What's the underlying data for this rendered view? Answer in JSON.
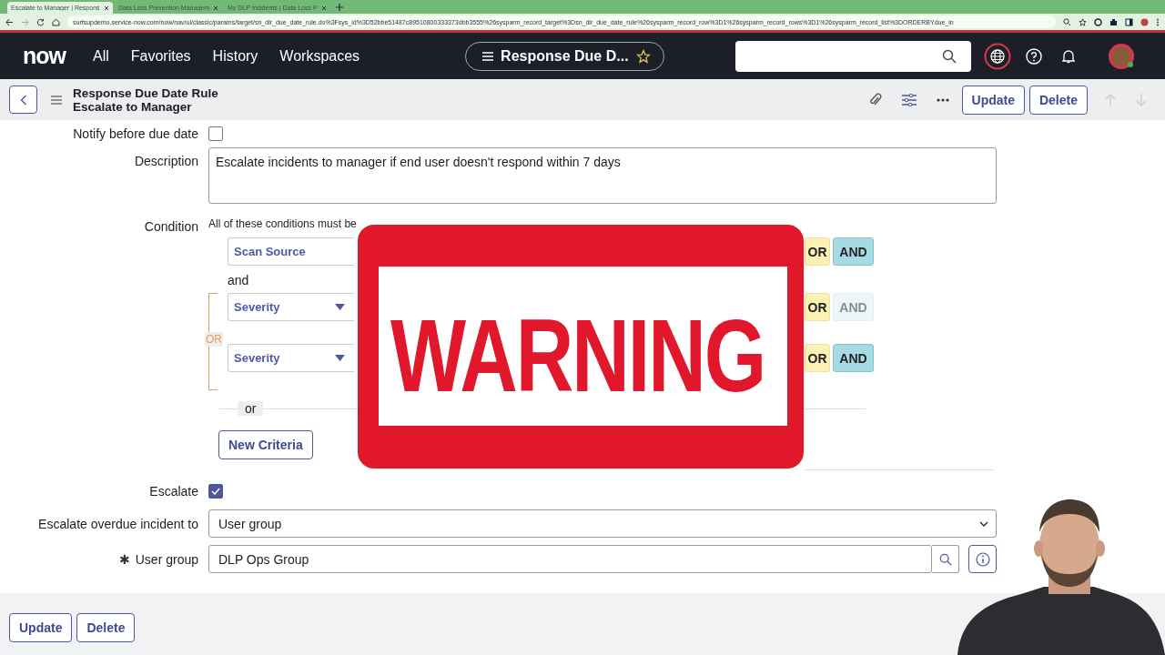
{
  "browser": {
    "tabs": [
      {
        "title": "Escalate to Manager | Respons",
        "selected": true
      },
      {
        "title": "Data Loss Prevention Managem",
        "selected": false
      },
      {
        "title": "My DLP Incidents | Data Loss P",
        "selected": false
      }
    ],
    "url": "surfsupdemo.service-now.com/now/nav/ui/classic/params/target/sn_dlr_due_date_rule.do%3Fsys_id%3D52bbe51487c89510800333373dbb3555%26sysparm_record_target%3Dsn_dlr_due_date_rule%26sysparm_record_row%3D1%26sysparm_record_rows%3D1%26sysparm_record_list%3DORDERBYdue_in"
  },
  "nav": {
    "logo": "now",
    "items": [
      "All",
      "Favorites",
      "History",
      "Workspaces"
    ],
    "context": "Response Due D..."
  },
  "record": {
    "type": "Response Due Date Rule",
    "name": "Escalate to Manager",
    "actions": [
      "Update",
      "Delete"
    ]
  },
  "form": [
    {
      "kind": "checkbox",
      "label": "Notify before due date",
      "checked": false
    },
    {
      "kind": "textarea",
      "label": "Description",
      "value": "Escalate incidents to manager if end user doesn't respond within 7 days"
    },
    {
      "kind": "condition",
      "label": "Condition",
      "hint": "All of these conditions must be",
      "rows": [
        {
          "kind": "criterion",
          "field": "Scan Source",
          "or": "OR",
          "and": "AND",
          "and_disabled": false
        },
        {
          "kind": "joiner",
          "text": "and"
        },
        {
          "kind": "or_group",
          "label": "OR",
          "rows": [
            {
              "field": "Severity",
              "or": "OR",
              "and": "AND",
              "and_disabled": true
            },
            {
              "field": "Severity",
              "or": "OR",
              "and": "AND",
              "and_disabled": false
            }
          ]
        }
      ],
      "separator": "or",
      "new_criteria": "New Criteria"
    },
    {
      "kind": "checkbox",
      "label": "Escalate",
      "checked": true
    },
    {
      "kind": "select",
      "label": "Escalate overdue incident to",
      "value": "User group"
    },
    {
      "kind": "reference",
      "label": "User group",
      "required_mark": "✱",
      "value": "DLP Ops Group"
    }
  ],
  "footer_actions": [
    "Update",
    "Delete"
  ],
  "stamp": {
    "text": "WARNING"
  },
  "webcam": {
    "kind": "picture"
  }
}
